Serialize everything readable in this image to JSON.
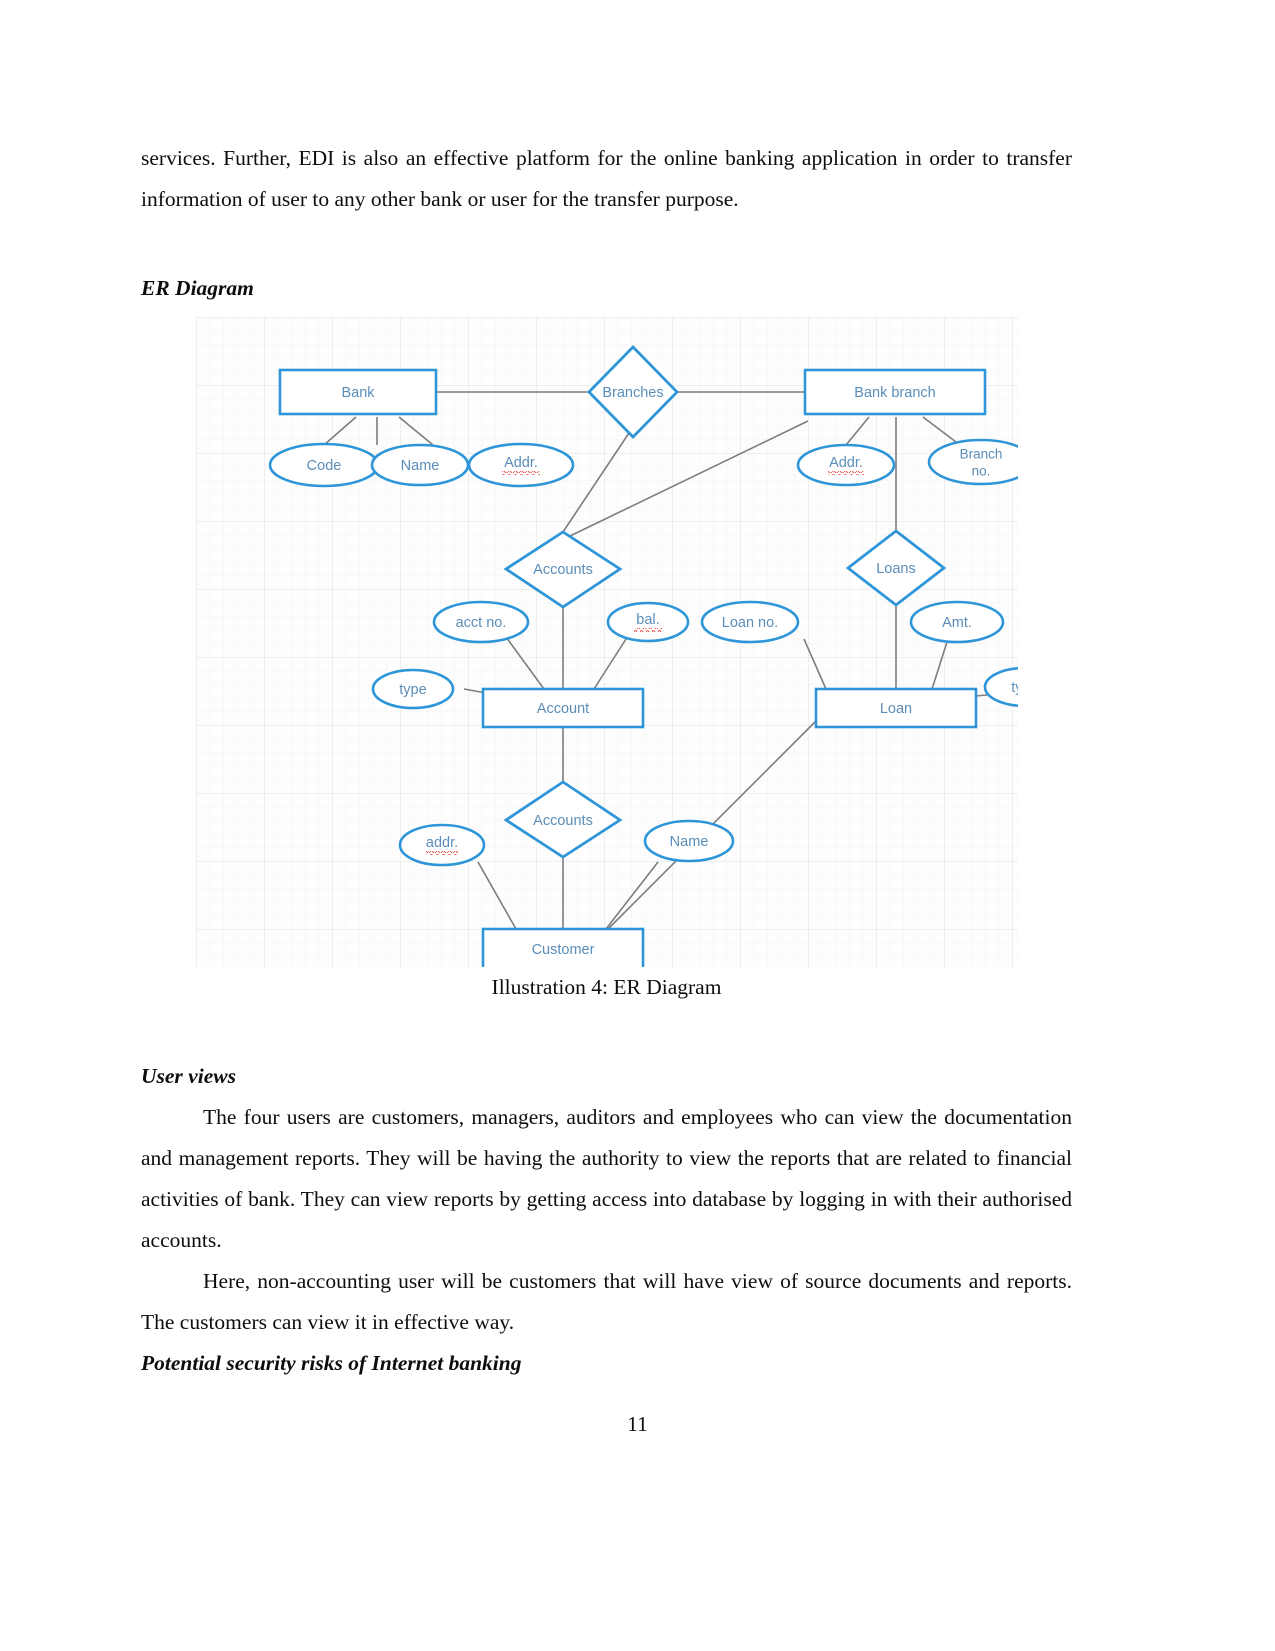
{
  "document": {
    "page_number": "11",
    "paragraph_1": "services. Further, EDI is also an effective platform for the online banking application in order to transfer information of user to any other bank or user for the transfer purpose.",
    "heading_er": "ER Diagram",
    "figure_caption": "Illustration 4: ER Diagram",
    "heading_user_views": "User views",
    "paragraph_user_views_1": "The four users are customers, managers, auditors and employees who can view the documentation and management reports. They will be having the authority to view the reports that are related to financial activities of bank. They can view reports by getting access into database by logging in with their authorised accounts.",
    "paragraph_user_views_2": "Here, non-accounting user will be customers that will have view of source documents and reports. The customers can view it in effective way.",
    "heading_security": "Potential security risks of Internet banking"
  },
  "colors": {
    "entity_stroke": "#2e96d8",
    "attribute_stroke": "#2e96d8",
    "relationship_stroke": "#2e96d8",
    "label_text": "#5b8db8",
    "connector": "#7a7a7a",
    "grid": "#ececec",
    "spellcheck_underline": "#e8493b"
  },
  "er_diagram": {
    "entities": [
      {
        "id": "bank",
        "label": "Bank"
      },
      {
        "id": "bank-branch",
        "label": "Bank branch"
      },
      {
        "id": "account",
        "label": "Account"
      },
      {
        "id": "loan",
        "label": "Loan"
      },
      {
        "id": "customer",
        "label": "Customer"
      }
    ],
    "relationships": [
      {
        "id": "branches",
        "label": "Branches"
      },
      {
        "id": "accounts-top",
        "label": "Accounts"
      },
      {
        "id": "loans",
        "label": "Loans"
      },
      {
        "id": "accounts-bottom",
        "label": "Accounts"
      }
    ],
    "attributes": [
      {
        "id": "bank-code",
        "label": "Code",
        "owner": "bank"
      },
      {
        "id": "bank-name",
        "label": "Name",
        "owner": "bank"
      },
      {
        "id": "bank-addr",
        "label": "Addr.",
        "owner": "bank",
        "misspelled": true
      },
      {
        "id": "branch-addr",
        "label": "Addr.",
        "owner": "bank-branch",
        "misspelled": true
      },
      {
        "id": "branch-no",
        "label": "Branch no.",
        "owner": "bank-branch"
      },
      {
        "id": "acct-no",
        "label": "acct no.",
        "owner": "account"
      },
      {
        "id": "acct-bal",
        "label": "bal.",
        "owner": "account",
        "misspelled": true
      },
      {
        "id": "acct-type",
        "label": "type",
        "owner": "account"
      },
      {
        "id": "loan-no",
        "label": "Loan no.",
        "owner": "loan"
      },
      {
        "id": "loan-amt",
        "label": "Amt.",
        "owner": "loan"
      },
      {
        "id": "loan-type",
        "label": "type",
        "owner": "loan"
      },
      {
        "id": "cust-addr",
        "label": "addr.",
        "owner": "customer",
        "misspelled": true
      },
      {
        "id": "cust-name",
        "label": "Name",
        "owner": "customer"
      }
    ]
  }
}
